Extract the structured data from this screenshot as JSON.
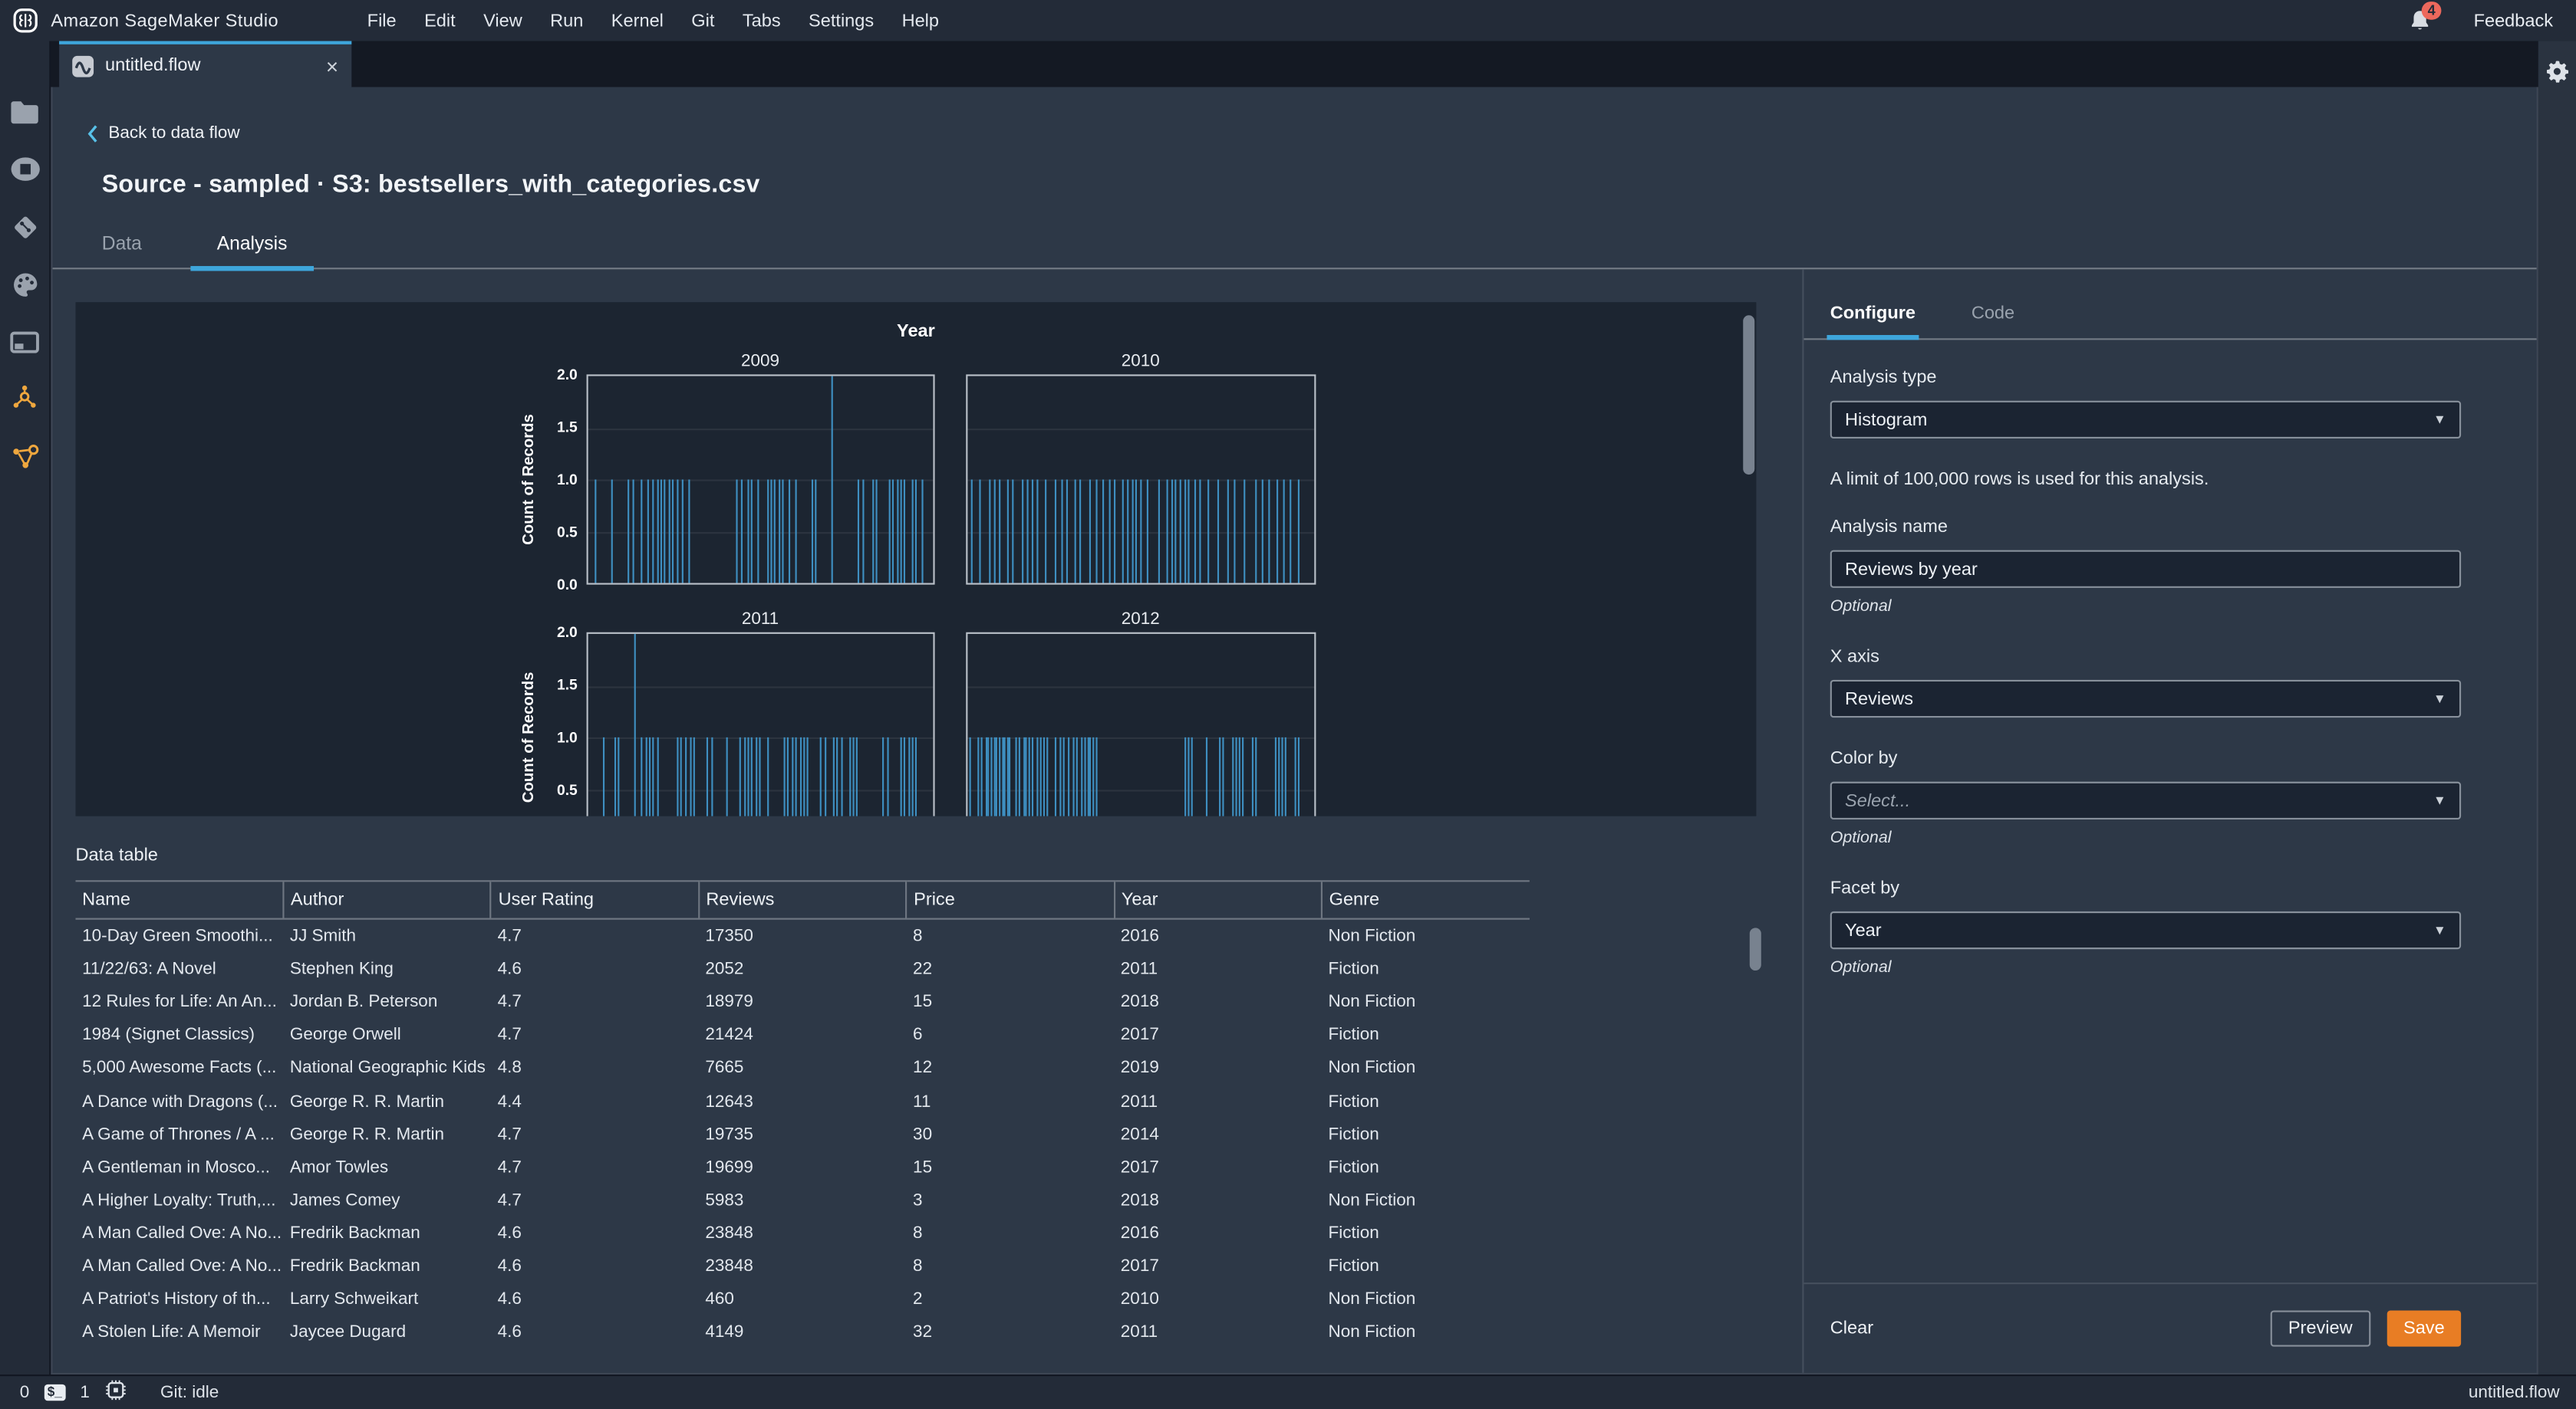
{
  "topbar": {
    "app_title": "Amazon SageMaker Studio",
    "menus": [
      "File",
      "Edit",
      "View",
      "Run",
      "Kernel",
      "Git",
      "Tabs",
      "Settings",
      "Help"
    ],
    "notification_count": "4",
    "feedback_label": "Feedback"
  },
  "tab_bar": {
    "active_tab_label": "untitled.flow",
    "close_glyph": "×"
  },
  "page": {
    "back_link": "Back to data flow",
    "title": "Source - sampled · S3: bestsellers_with_categories.csv",
    "tabs": [
      {
        "label": "Data",
        "active": false
      },
      {
        "label": "Analysis",
        "active": true
      }
    ]
  },
  "chart_data": {
    "type": "bar",
    "subtype": "faceted-histogram",
    "title": "Year",
    "ylabel": "Count of Records",
    "ylim": [
      0,
      2
    ],
    "yticks": [
      "2.0",
      "1.5",
      "1.0",
      "0.5",
      "0.0"
    ],
    "grid": true,
    "columns": 2,
    "bar_color": "#3e8fc1",
    "facets": [
      {
        "label": "2009",
        "bars": [
          [
            0.02,
            1
          ],
          [
            0.07,
            1
          ],
          [
            0.115,
            1
          ],
          [
            0.13,
            1
          ],
          [
            0.155,
            1
          ],
          [
            0.175,
            1
          ],
          [
            0.19,
            1
          ],
          [
            0.2,
            1
          ],
          [
            0.21,
            1
          ],
          [
            0.22,
            1
          ],
          [
            0.235,
            1
          ],
          [
            0.245,
            1
          ],
          [
            0.26,
            1
          ],
          [
            0.275,
            1
          ],
          [
            0.29,
            1
          ],
          [
            0.43,
            1
          ],
          [
            0.445,
            1
          ],
          [
            0.465,
            1
          ],
          [
            0.475,
            1
          ],
          [
            0.49,
            1
          ],
          [
            0.52,
            1
          ],
          [
            0.53,
            1
          ],
          [
            0.54,
            1
          ],
          [
            0.555,
            1
          ],
          [
            0.565,
            1
          ],
          [
            0.58,
            1
          ],
          [
            0.6,
            1
          ],
          [
            0.65,
            1
          ],
          [
            0.66,
            1
          ],
          [
            0.705,
            2
          ],
          [
            0.78,
            1
          ],
          [
            0.795,
            1
          ],
          [
            0.825,
            1
          ],
          [
            0.835,
            1
          ],
          [
            0.87,
            1
          ],
          [
            0.88,
            1
          ],
          [
            0.895,
            1
          ],
          [
            0.905,
            1
          ],
          [
            0.915,
            1
          ],
          [
            0.94,
            1
          ],
          [
            0.95,
            1
          ],
          [
            0.965,
            1
          ]
        ]
      },
      {
        "label": "2010",
        "bars": [
          [
            0.01,
            1
          ],
          [
            0.035,
            1
          ],
          [
            0.06,
            1
          ],
          [
            0.075,
            1
          ],
          [
            0.09,
            1
          ],
          [
            0.115,
            1
          ],
          [
            0.13,
            1
          ],
          [
            0.155,
            1
          ],
          [
            0.17,
            1
          ],
          [
            0.185,
            1
          ],
          [
            0.2,
            1
          ],
          [
            0.225,
            1
          ],
          [
            0.25,
            1
          ],
          [
            0.27,
            1
          ],
          [
            0.285,
            1
          ],
          [
            0.31,
            1
          ],
          [
            0.325,
            1
          ],
          [
            0.35,
            1
          ],
          [
            0.37,
            1
          ],
          [
            0.39,
            1
          ],
          [
            0.41,
            1
          ],
          [
            0.425,
            1
          ],
          [
            0.445,
            1
          ],
          [
            0.46,
            1
          ],
          [
            0.475,
            1
          ],
          [
            0.485,
            1
          ],
          [
            0.5,
            1
          ],
          [
            0.52,
            1
          ],
          [
            0.55,
            1
          ],
          [
            0.575,
            1
          ],
          [
            0.59,
            1
          ],
          [
            0.6,
            1
          ],
          [
            0.615,
            1
          ],
          [
            0.625,
            1
          ],
          [
            0.635,
            1
          ],
          [
            0.655,
            1
          ],
          [
            0.67,
            1
          ],
          [
            0.695,
            1
          ],
          [
            0.72,
            1
          ],
          [
            0.75,
            1
          ],
          [
            0.77,
            1
          ],
          [
            0.8,
            1
          ],
          [
            0.83,
            1
          ],
          [
            0.85,
            1
          ],
          [
            0.87,
            1
          ],
          [
            0.895,
            1
          ],
          [
            0.91,
            1
          ],
          [
            0.93,
            1
          ],
          [
            0.955,
            1
          ]
        ]
      },
      {
        "label": "2011",
        "bars": [
          [
            0.043,
            1
          ],
          [
            0.078,
            1
          ],
          [
            0.09,
            1
          ],
          [
            0.136,
            2
          ],
          [
            0.155,
            1
          ],
          [
            0.167,
            1
          ],
          [
            0.178,
            1
          ],
          [
            0.19,
            1
          ],
          [
            0.2,
            1
          ],
          [
            0.26,
            1
          ],
          [
            0.27,
            1
          ],
          [
            0.284,
            1
          ],
          [
            0.295,
            1
          ],
          [
            0.307,
            1
          ],
          [
            0.346,
            1
          ],
          [
            0.357,
            1
          ],
          [
            0.403,
            1
          ],
          [
            0.44,
            1
          ],
          [
            0.454,
            1
          ],
          [
            0.465,
            1
          ],
          [
            0.473,
            1
          ],
          [
            0.485,
            1
          ],
          [
            0.496,
            1
          ],
          [
            0.52,
            1
          ],
          [
            0.566,
            1
          ],
          [
            0.578,
            1
          ],
          [
            0.59,
            1
          ],
          [
            0.6,
            1
          ],
          [
            0.613,
            1
          ],
          [
            0.625,
            1
          ],
          [
            0.636,
            1
          ],
          [
            0.674,
            1
          ],
          [
            0.687,
            1
          ],
          [
            0.71,
            1
          ],
          [
            0.72,
            1
          ],
          [
            0.733,
            1
          ],
          [
            0.76,
            1
          ],
          [
            0.767,
            1
          ],
          [
            0.775,
            1
          ],
          [
            0.853,
            1
          ],
          [
            0.865,
            1
          ],
          [
            0.904,
            1
          ],
          [
            0.915,
            1
          ],
          [
            0.927,
            1
          ],
          [
            0.938,
            1
          ],
          [
            0.95,
            1
          ]
        ]
      },
      {
        "label": "2012",
        "bars": [
          [
            0.005,
            1
          ],
          [
            0.028,
            1
          ],
          [
            0.039,
            1
          ],
          [
            0.051,
            1
          ],
          [
            0.059,
            1
          ],
          [
            0.067,
            1
          ],
          [
            0.074,
            1
          ],
          [
            0.082,
            1
          ],
          [
            0.09,
            1
          ],
          [
            0.098,
            1
          ],
          [
            0.105,
            1
          ],
          [
            0.113,
            1
          ],
          [
            0.121,
            1
          ],
          [
            0.136,
            1
          ],
          [
            0.147,
            1
          ],
          [
            0.16,
            1
          ],
          [
            0.167,
            1
          ],
          [
            0.175,
            1
          ],
          [
            0.183,
            1
          ],
          [
            0.198,
            1
          ],
          [
            0.209,
            1
          ],
          [
            0.217,
            1
          ],
          [
            0.229,
            1
          ],
          [
            0.253,
            1
          ],
          [
            0.264,
            1
          ],
          [
            0.276,
            1
          ],
          [
            0.291,
            1
          ],
          [
            0.302,
            1
          ],
          [
            0.315,
            1
          ],
          [
            0.326,
            1
          ],
          [
            0.338,
            1
          ],
          [
            0.346,
            1
          ],
          [
            0.353,
            1
          ],
          [
            0.361,
            1
          ],
          [
            0.369,
            1
          ],
          [
            0.625,
            1
          ],
          [
            0.636,
            1
          ],
          [
            0.648,
            1
          ],
          [
            0.687,
            1
          ],
          [
            0.726,
            1
          ],
          [
            0.736,
            1
          ],
          [
            0.764,
            1
          ],
          [
            0.772,
            1
          ],
          [
            0.783,
            1
          ],
          [
            0.791,
            1
          ],
          [
            0.822,
            1
          ],
          [
            0.829,
            1
          ],
          [
            0.888,
            1
          ],
          [
            0.896,
            1
          ],
          [
            0.907,
            1
          ],
          [
            0.915,
            1
          ],
          [
            0.946,
            1
          ],
          [
            0.953,
            1
          ]
        ]
      }
    ]
  },
  "data_table": {
    "label": "Data table",
    "columns": [
      "Name",
      "Author",
      "User Rating",
      "Reviews",
      "Price",
      "Year",
      "Genre"
    ],
    "rows": [
      [
        "10-Day Green Smoothi...",
        "JJ Smith",
        "4.7",
        "17350",
        "8",
        "2016",
        "Non Fiction"
      ],
      [
        "11/22/63: A Novel",
        "Stephen King",
        "4.6",
        "2052",
        "22",
        "2011",
        "Fiction"
      ],
      [
        "12 Rules for Life: An An...",
        "Jordan B. Peterson",
        "4.7",
        "18979",
        "15",
        "2018",
        "Non Fiction"
      ],
      [
        "1984 (Signet Classics)",
        "George Orwell",
        "4.7",
        "21424",
        "6",
        "2017",
        "Fiction"
      ],
      [
        "5,000 Awesome Facts (...",
        "National Geographic Kids",
        "4.8",
        "7665",
        "12",
        "2019",
        "Non Fiction"
      ],
      [
        "A Dance with Dragons (...",
        "George R. R. Martin",
        "4.4",
        "12643",
        "11",
        "2011",
        "Fiction"
      ],
      [
        "A Game of Thrones / A ...",
        "George R. R. Martin",
        "4.7",
        "19735",
        "30",
        "2014",
        "Fiction"
      ],
      [
        "A Gentleman in Mosco...",
        "Amor Towles",
        "4.7",
        "19699",
        "15",
        "2017",
        "Fiction"
      ],
      [
        "A Higher Loyalty: Truth,...",
        "James Comey",
        "4.7",
        "5983",
        "3",
        "2018",
        "Non Fiction"
      ],
      [
        "A Man Called Ove: A No...",
        "Fredrik Backman",
        "4.6",
        "23848",
        "8",
        "2016",
        "Fiction"
      ],
      [
        "A Man Called Ove: A No...",
        "Fredrik Backman",
        "4.6",
        "23848",
        "8",
        "2017",
        "Fiction"
      ],
      [
        "A Patriot's History of th...",
        "Larry Schweikart",
        "4.6",
        "460",
        "2",
        "2010",
        "Non Fiction"
      ],
      [
        "A Stolen Life: A Memoir",
        "Jaycee Dugard",
        "4.6",
        "4149",
        "32",
        "2011",
        "Non Fiction"
      ]
    ]
  },
  "config_panel": {
    "tabs": [
      {
        "label": "Configure",
        "active": true
      },
      {
        "label": "Code",
        "active": false
      }
    ],
    "analysis_type": {
      "label": "Analysis type",
      "value": "Histogram"
    },
    "limit_note": "A limit of 100,000 rows is used for this analysis.",
    "analysis_name": {
      "label": "Analysis name",
      "value": "Reviews by year",
      "optional": "Optional"
    },
    "x_axis": {
      "label": "X axis",
      "value": "Reviews"
    },
    "color_by": {
      "label": "Color by",
      "placeholder": "Select...",
      "optional": "Optional"
    },
    "facet_by": {
      "label": "Facet by",
      "value": "Year",
      "optional": "Optional"
    },
    "footer": {
      "clear": "Clear",
      "preview": "Preview",
      "save": "Save"
    }
  },
  "status_bar": {
    "terminal_count": "0",
    "kernel_count": "1",
    "git_status": "Git: idle",
    "file_label": "untitled.flow"
  },
  "icons": {
    "dropdown_caret": "▼",
    "close_glyph": "×",
    "terminal_glyph": "$_"
  },
  "colors": {
    "accent_blue": "#3ea6dc",
    "bar_blue": "#3e8fc1",
    "save_orange": "#e87d24",
    "badge_red": "#ec685c",
    "chart_bg": "#1c2531",
    "panel_bg": "#2d3847",
    "chrome_bg": "#232b38"
  }
}
